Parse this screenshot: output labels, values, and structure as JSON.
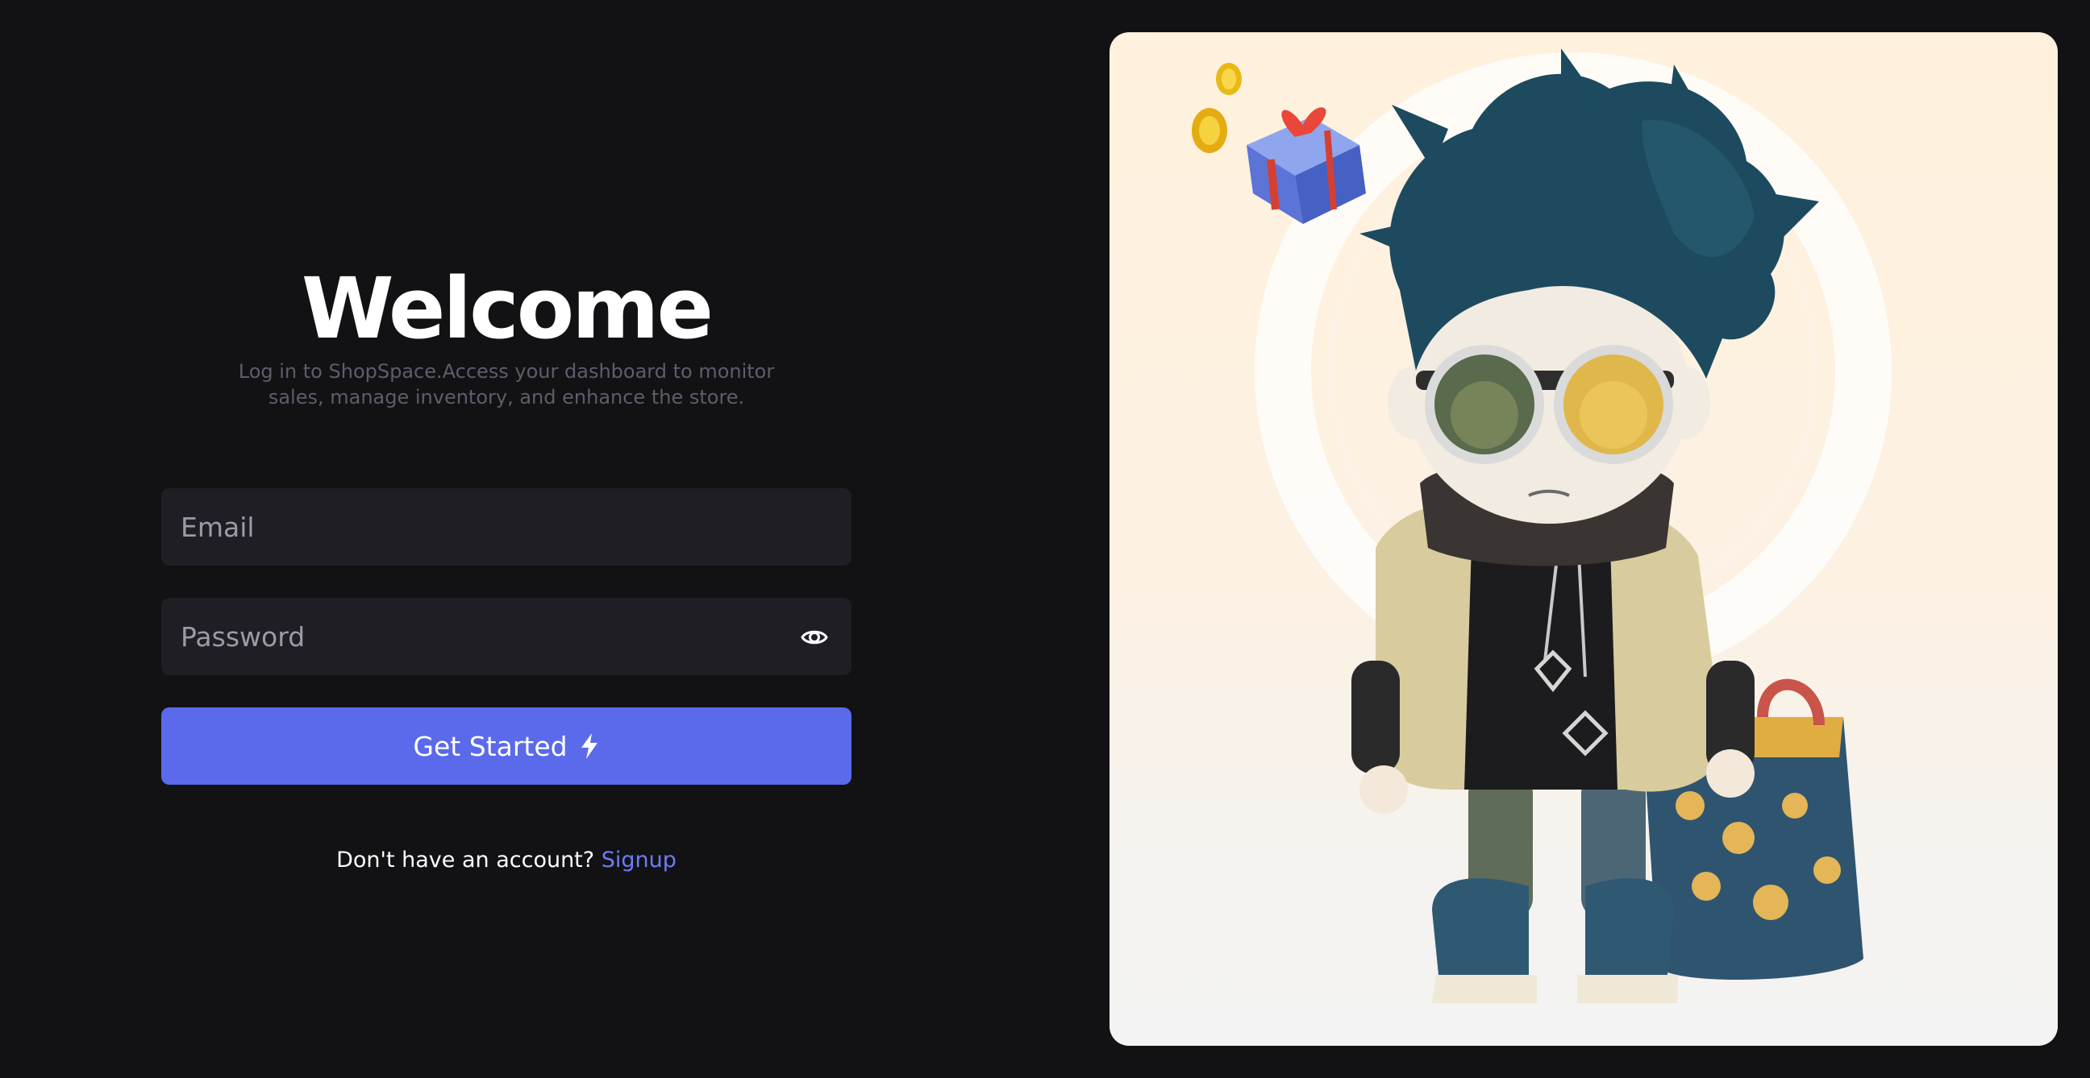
{
  "login": {
    "title": "Welcome",
    "subtitle": "Log in to ShopSpace.Access your dashboard to monitor sales, manage inventory, and enhance the store.",
    "email_placeholder": "Email",
    "password_placeholder": "Password",
    "submit_label": "Get Started",
    "no_account_text": "Don't have an account?",
    "signup_label": "Signup"
  },
  "icons": {
    "password_toggle": "eye-icon",
    "submit": "lightning-bolt-icon"
  },
  "illustration": {
    "subject": "3d-character-with-shopping-bag",
    "accessories": [
      "gift-box",
      "gold-coins",
      "sunglasses",
      "tote-bag"
    ]
  },
  "colors": {
    "background": "#121214",
    "input_bg": "#1e1e24",
    "accent": "#5a6aea",
    "link": "#6e7cf6",
    "subtitle": "#5d5d6c",
    "card_bg": "#fff1dd"
  }
}
